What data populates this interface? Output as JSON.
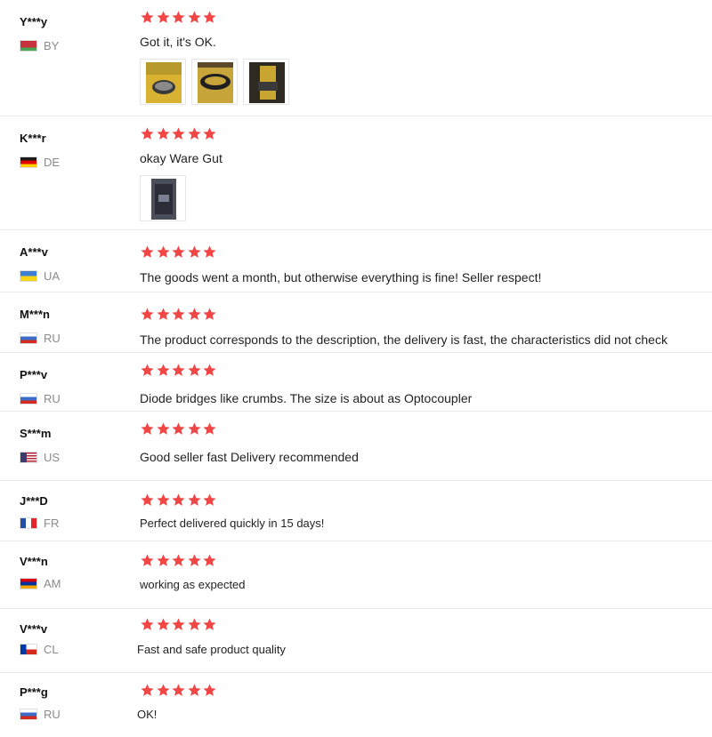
{
  "colors": {
    "star": "#f04646",
    "divider": "#ebebeb",
    "country_text": "#8a8a8a"
  },
  "star_icon": "star-icon",
  "reviews": [
    {
      "user": "Y***y",
      "country": "BY",
      "flag": "belarus-flag",
      "rating": 5,
      "text": "Got it, it's OK.",
      "photos": 3
    },
    {
      "user": "K***r",
      "country": "DE",
      "flag": "germany-flag",
      "rating": 5,
      "text": "okay Ware Gut",
      "photos": 1
    },
    {
      "user": "A***v",
      "country": "UA",
      "flag": "ukraine-flag",
      "rating": 5,
      "text": "The goods went a month, but otherwise everything is fine! Seller respect!",
      "photos": 0
    },
    {
      "user": "M***n",
      "country": "RU",
      "flag": "russia-flag",
      "rating": 5,
      "text": "The product corresponds to the description, the delivery is fast, the characteristics did not check",
      "photos": 0
    },
    {
      "user": "P***v",
      "country": "RU",
      "flag": "russia-flag",
      "rating": 5,
      "text": "Diode bridges like crumbs. The size is about as Optocoupler",
      "photos": 0
    },
    {
      "user": "S***m",
      "country": "US",
      "flag": "usa-flag",
      "rating": 5,
      "text": "Good seller fast Delivery recommended",
      "photos": 0
    },
    {
      "user": "J***D",
      "country": "FR",
      "flag": "france-flag",
      "rating": 5,
      "text": "Perfect delivered quickly in 15 days!",
      "photos": 0
    },
    {
      "user": "V***n",
      "country": "AM",
      "flag": "armenia-flag",
      "rating": 5,
      "text": "working as expected",
      "photos": 0
    },
    {
      "user": "V***v",
      "country": "CL",
      "flag": "chile-flag",
      "rating": 5,
      "text": "Fast and safe product quality",
      "photos": 0
    },
    {
      "user": "P***g",
      "country": "RU",
      "flag": "russia-flag",
      "rating": 5,
      "text": "OK!",
      "photos": 0
    }
  ]
}
